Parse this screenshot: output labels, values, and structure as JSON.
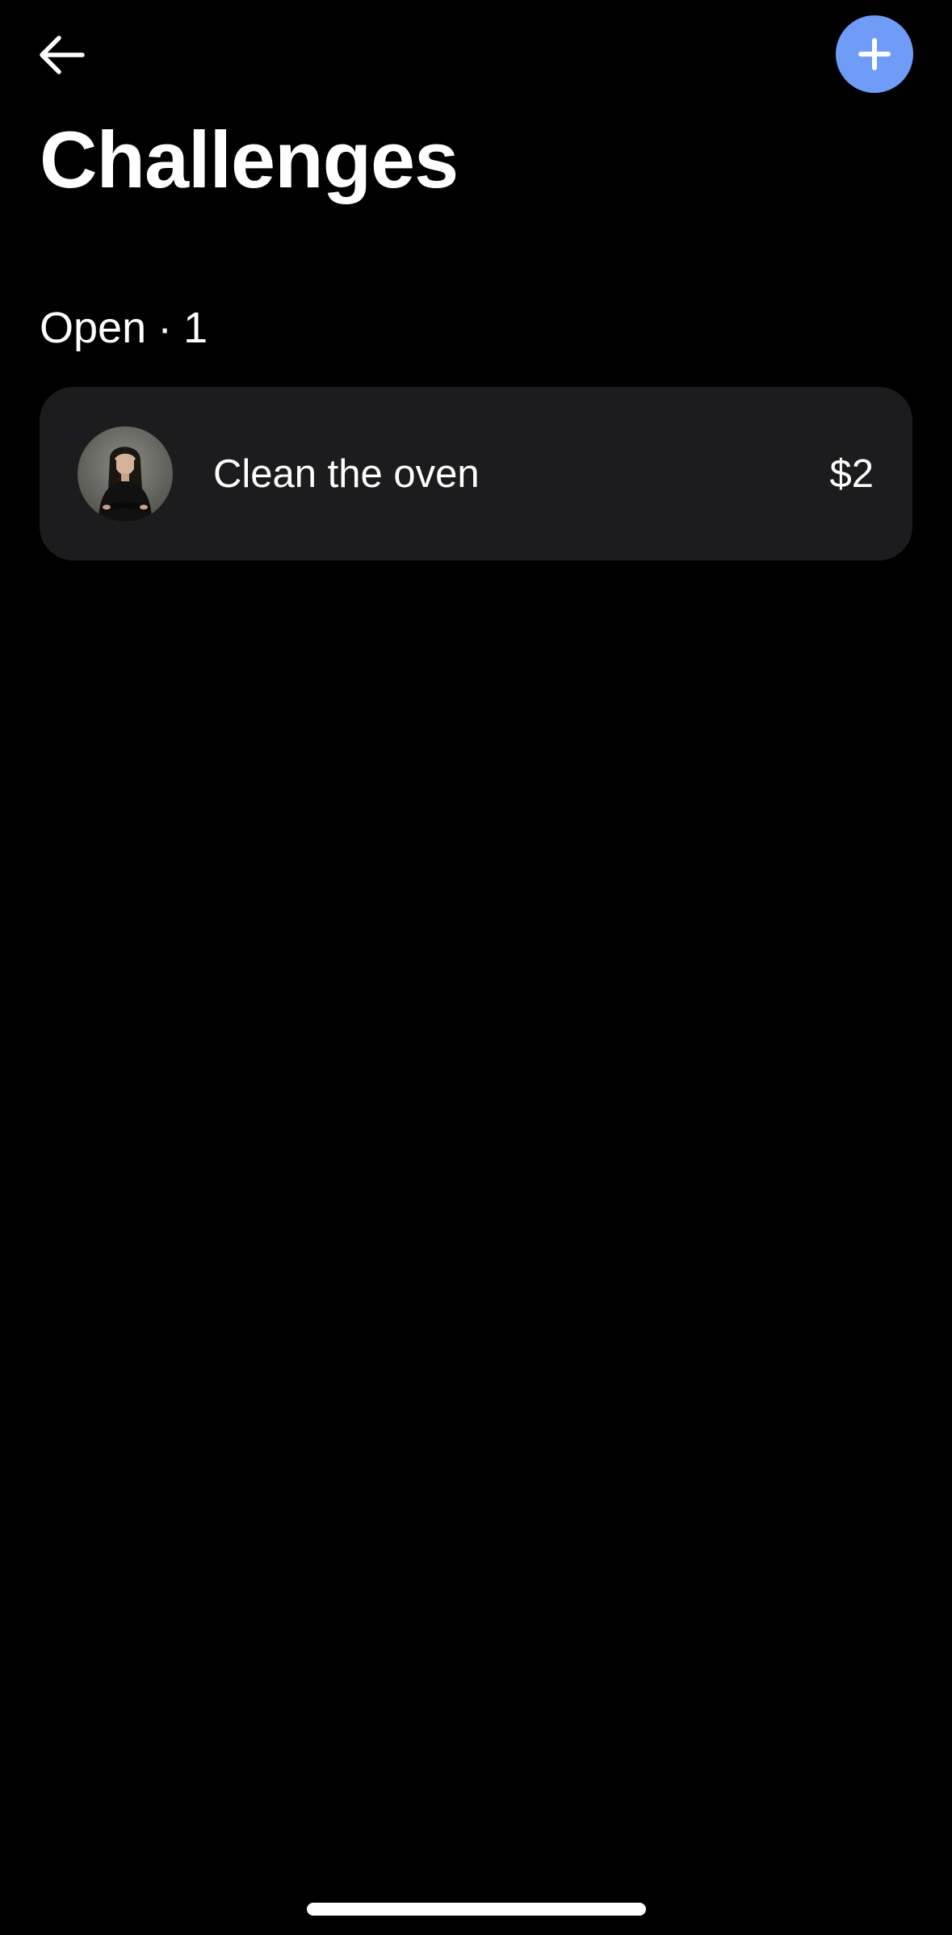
{
  "colors": {
    "background": "#000000",
    "card_background": "#1c1c1e",
    "accent": "#6e9cf7",
    "text": "#ffffff"
  },
  "header": {
    "back_icon": "arrow-left-icon",
    "add_icon": "plus-icon",
    "title": "Challenges"
  },
  "section": {
    "label": "Open",
    "separator": "·",
    "count": "1"
  },
  "challenges": [
    {
      "avatar_icon": "user-avatar-photo",
      "title": "Clean the oven",
      "amount": "$2"
    }
  ]
}
